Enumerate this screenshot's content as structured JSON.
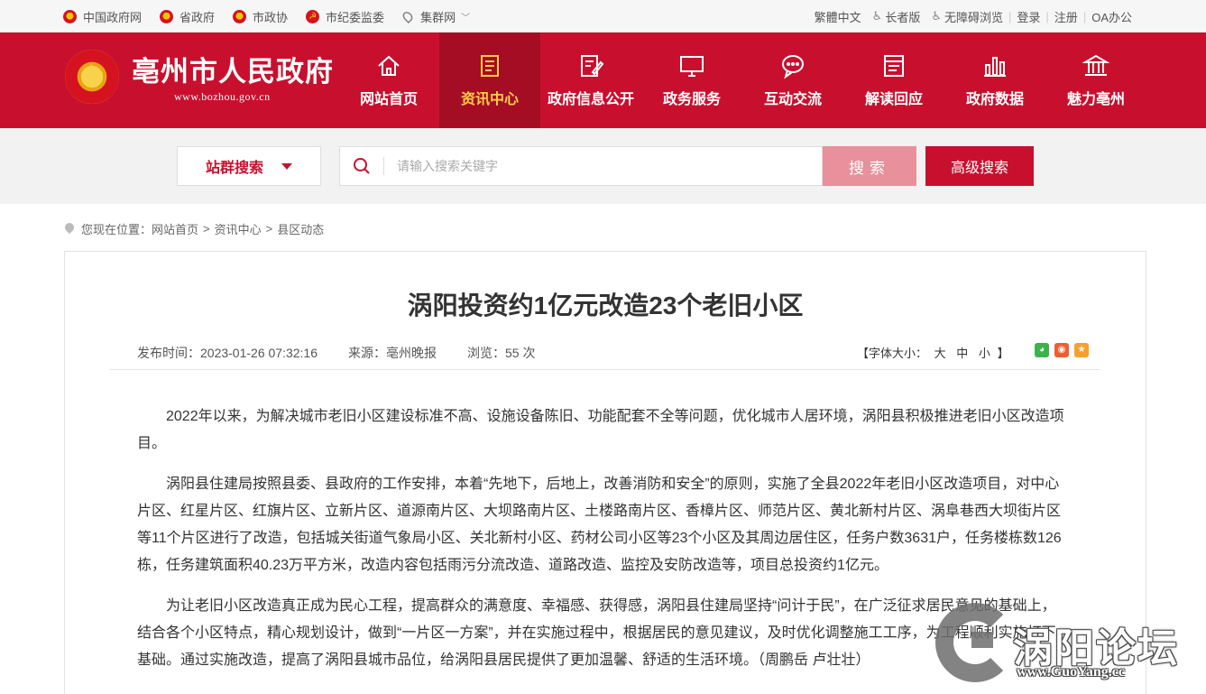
{
  "topbar": {
    "left_links": [
      {
        "label": "中国政府网",
        "icon": "emblem-icon"
      },
      {
        "label": "省政府",
        "icon": "emblem-icon"
      },
      {
        "label": "市政协",
        "icon": "emblem-icon"
      },
      {
        "label": "市纪委监委",
        "icon": "ccdi-icon"
      },
      {
        "label": "集群网",
        "icon": "location-pin-icon"
      }
    ],
    "right_links": [
      "繁體中文",
      "长者版",
      "无障碍浏览",
      "登录",
      "注册",
      "OA办公"
    ]
  },
  "header": {
    "site_title": "亳州市人民政府",
    "site_url": "www.bozhou.gov.cn",
    "nav": [
      {
        "label": "网站首页",
        "icon": "home-icon",
        "active": false
      },
      {
        "label": "资讯中心",
        "icon": "news-icon",
        "active": true
      },
      {
        "label": "政府信息公开",
        "icon": "edit-document-icon",
        "active": false
      },
      {
        "label": "政务服务",
        "icon": "monitor-icon",
        "active": false
      },
      {
        "label": "互动交流",
        "icon": "chat-bubble-icon",
        "active": false
      },
      {
        "label": "解读回应",
        "icon": "reading-icon",
        "active": false
      },
      {
        "label": "政府数据",
        "icon": "bar-chart-icon",
        "active": false
      },
      {
        "label": "魅力亳州",
        "icon": "building-icon",
        "active": false
      }
    ]
  },
  "search": {
    "scope_label": "站群搜索",
    "placeholder": "请输入搜索关键字",
    "value": "",
    "search_label": "搜索",
    "advanced_label": "高级搜索"
  },
  "breadcrumb": {
    "prefix": "您现在位置：",
    "items": [
      "网站首页",
      "资讯中心",
      "县区动态"
    ]
  },
  "article": {
    "title": "涡阳投资约1亿元改造23个老旧小区",
    "publish_time": "发布时间：2023-01-26 07:32:16",
    "source": "来源：亳州晚报",
    "views": "浏览：55 次",
    "font_size": {
      "open": "【字体大小：",
      "large": "大",
      "medium": "中",
      "small": "小",
      "close": "】"
    },
    "paragraphs": [
      "2022年以来，为解决城市老旧小区建设标准不高、设施设备陈旧、功能配套不全等问题，优化城市人居环境，涡阳县积极推进老旧小区改造项目。",
      "涡阳县住建局按照县委、县政府的工作安排，本着“先地下，后地上，改善消防和安全”的原则，实施了全县2022年老旧小区改造项目，对中心片区、红星片区、红旗片区、立新片区、道源南片区、大坝路南片区、土楼路南片区、香樟片区、师范片区、黄北新村片区、涡阜巷西大坝街片区等11个片区进行了改造，包括城关街道气象局小区、关北新村小区、药材公司小区等23个小区及其周边居住区，任务户数3631户，任务楼栋数126栋，任务建筑面积40.23万平方米，改造内容包括雨污分流改造、道路改造、监控及安防改造等，项目总投资约1亿元。",
      "为让老旧小区改造真正成为民心工程，提高群众的满意度、幸福感、获得感，涡阳县住建局坚持“问计于民”，在广泛征求居民意见的基础上，结合各个小区特点，精心规划设计，做到“一片区一方案”，并在实施过程中，根据居民的意见建议，及时优化调整施工工序，为工程顺利实施打下基础。通过实施改造，提高了涡阳县城市品位，给涡阳县居民提供了更加温馨、舒适的生活环境。（周鹏岳 卢壮壮）"
    ]
  },
  "watermark": {
    "text": "涡阳论坛",
    "url": "www.GuoYang.cc"
  },
  "colors": {
    "brand_red": "#c8102e",
    "nav_active_bg": "#a50d24",
    "nav_active_text": "#ffd04a",
    "search_button": "#e8919c"
  }
}
